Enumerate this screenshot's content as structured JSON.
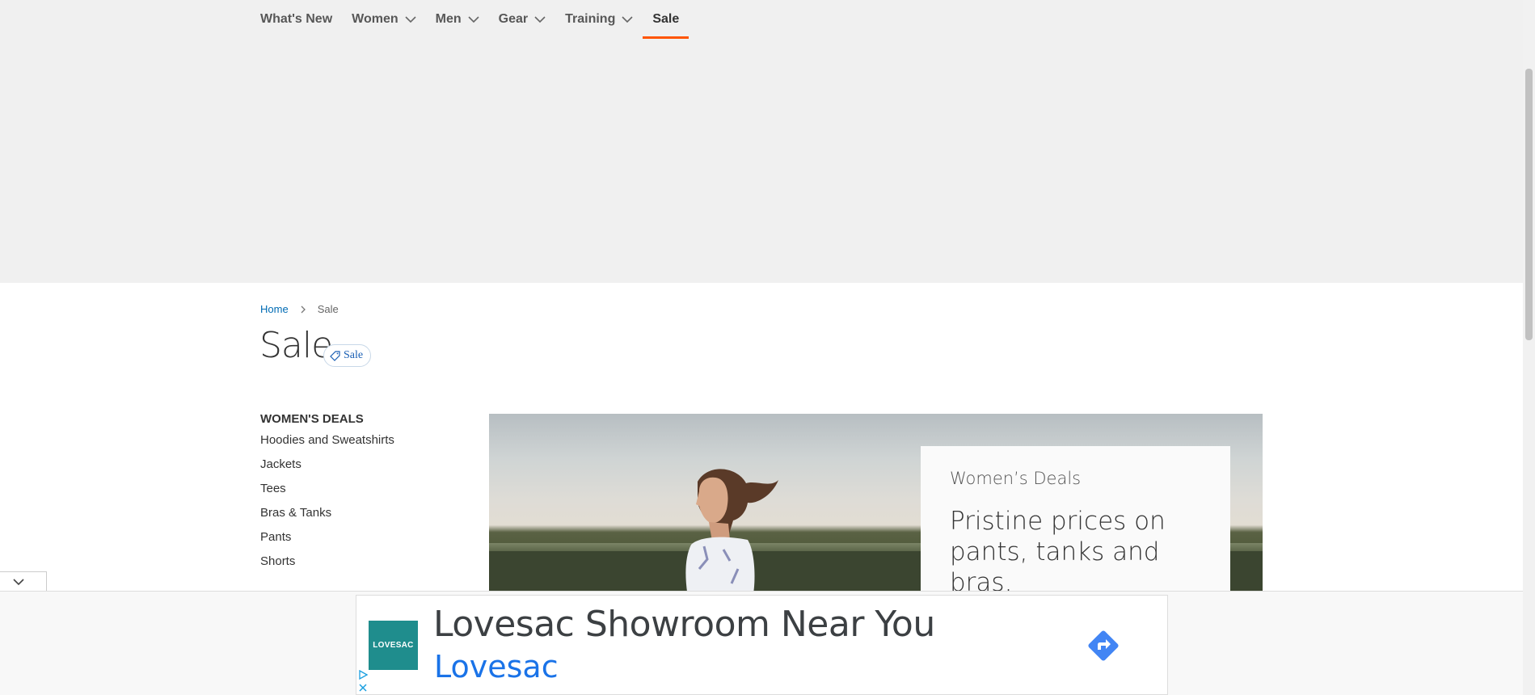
{
  "nav": {
    "items": [
      {
        "label": "What's New",
        "dropdown": false
      },
      {
        "label": "Women",
        "dropdown": true
      },
      {
        "label": "Men",
        "dropdown": true
      },
      {
        "label": "Gear",
        "dropdown": true
      },
      {
        "label": "Training",
        "dropdown": true
      },
      {
        "label": "Sale",
        "dropdown": false,
        "active": true
      }
    ],
    "accent_color": "#ff5501"
  },
  "breadcrumb": {
    "home": "Home",
    "current": "Sale"
  },
  "page": {
    "title": "Sale",
    "badge": "Sale"
  },
  "sidebar": {
    "heading": "WOMEN'S DEALS",
    "items": [
      "Hoodies and Sweatshirts",
      "Jackets",
      "Tees",
      "Bras & Tanks",
      "Pants",
      "Shorts"
    ]
  },
  "hero": {
    "kicker": "Women’s Deals",
    "headline": "Pristine prices on pants, tanks and bras."
  },
  "ad": {
    "logo_text": "LOVESAC",
    "title": "Lovesac Showroom Near You",
    "brand": "Lovesac",
    "brand_color": "#1a73e8"
  }
}
